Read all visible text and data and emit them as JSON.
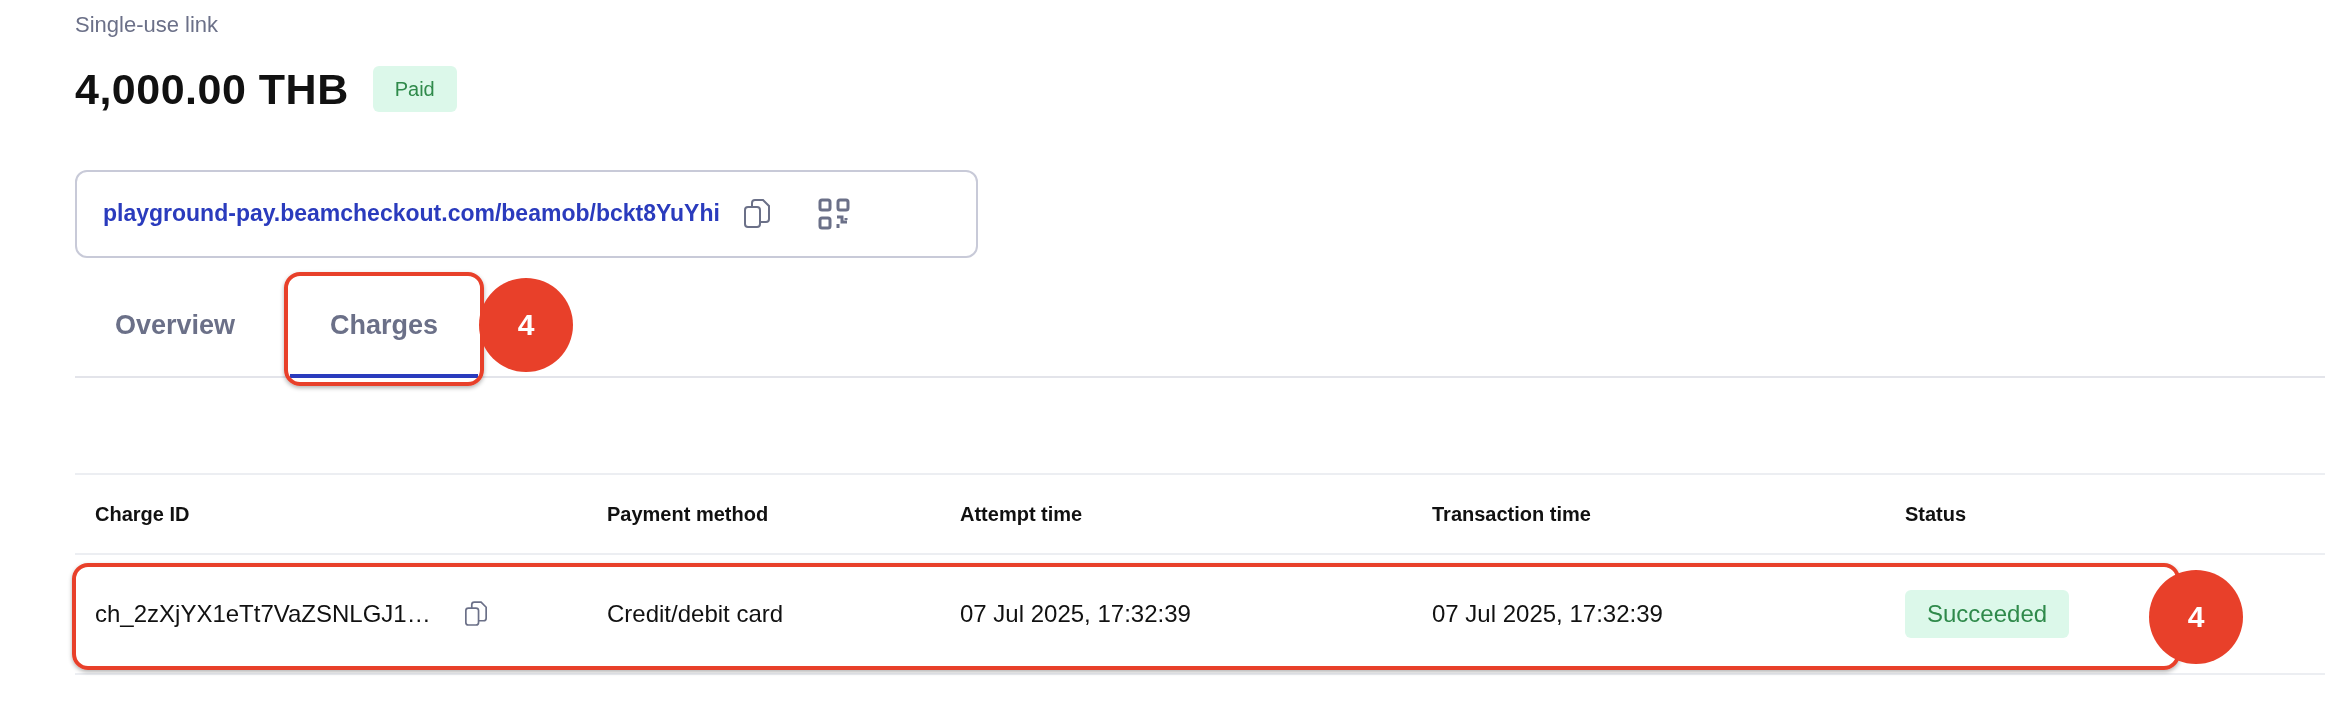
{
  "subtitle": "Single-use link",
  "amount": "4,000.00 THB",
  "payment_status": {
    "label": "Paid"
  },
  "link": {
    "url": "playground-pay.beamcheckout.com/beamob/bckt8YuYhi"
  },
  "tabs": [
    {
      "label": "Overview",
      "selected": false
    },
    {
      "label": "Charges",
      "selected": true,
      "callout": "4"
    }
  ],
  "table": {
    "columns": [
      "Charge ID",
      "Payment method",
      "Attempt time",
      "Transaction time",
      "Status"
    ],
    "rows": [
      {
        "charge_id": "ch_2zXjYX1eTt7VaZSNLGJ1…",
        "payment_method": "Credit/debit card",
        "attempt_time": "07 Jul 2025, 17:32:39",
        "transaction_time": "07 Jul 2025, 17:32:39",
        "status": "Succeeded",
        "callout": "4"
      }
    ]
  }
}
